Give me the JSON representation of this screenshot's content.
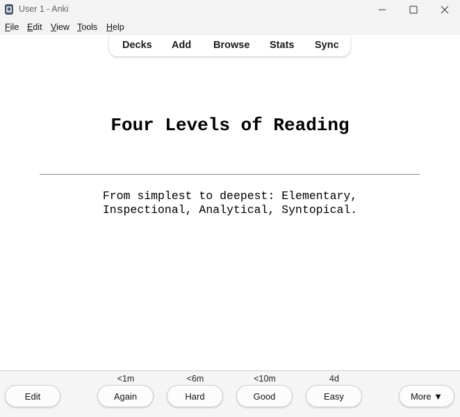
{
  "window": {
    "title": "User 1 - Anki"
  },
  "menubar": {
    "items": [
      {
        "accel": "F",
        "rest": "ile"
      },
      {
        "accel": "E",
        "rest": "dit"
      },
      {
        "accel": "V",
        "rest": "iew"
      },
      {
        "accel": "T",
        "rest": "ools"
      },
      {
        "accel": "H",
        "rest": "elp"
      }
    ]
  },
  "toolbar": {
    "decks": "Decks",
    "add": "Add",
    "browse": "Browse",
    "stats": "Stats",
    "sync": "Sync"
  },
  "card": {
    "front": "Four Levels of Reading",
    "back_line1": "From simplest to deepest: Elementary,",
    "back_line2": "Inspectional, Analytical, Syntopical."
  },
  "bottom": {
    "edit": "Edit",
    "more": "More ▼",
    "answers": [
      {
        "label": "Again",
        "interval": "<1m"
      },
      {
        "label": "Hard",
        "interval": "<6m"
      },
      {
        "label": "Good",
        "interval": "<10m"
      },
      {
        "label": "Easy",
        "interval": "4d"
      }
    ]
  },
  "icons": {
    "app": "anki-app-icon",
    "minimize": "minimize-icon",
    "maximize": "maximize-icon",
    "close": "close-icon"
  }
}
